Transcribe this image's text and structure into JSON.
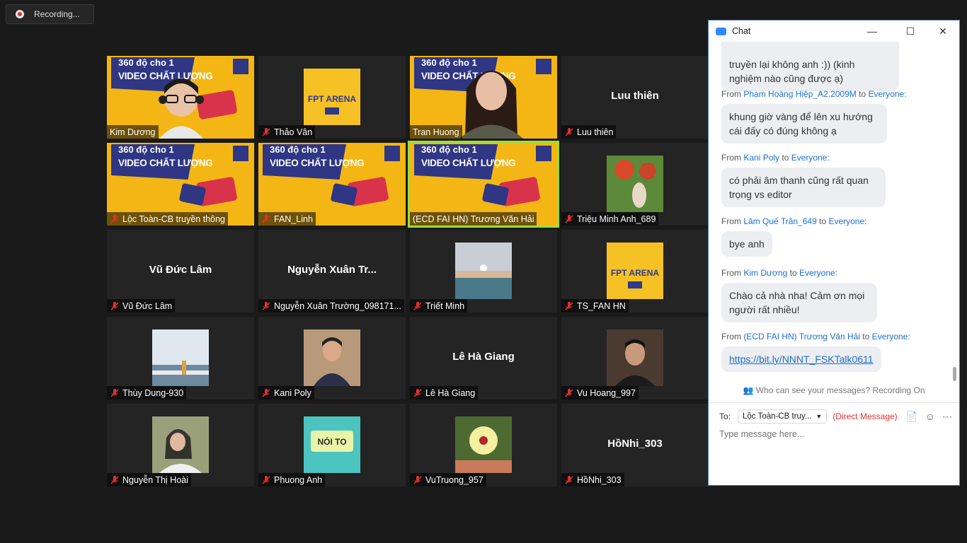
{
  "recording": {
    "label": "Recording..."
  },
  "tiles": [
    {
      "name": "Kim Dương"
    },
    {
      "name": "Thảo Vân"
    },
    {
      "name": "Tran Huong"
    },
    {
      "name": "Luu thiên",
      "big": "Luu thiên"
    },
    {
      "name": "Lộc Toàn-CB truyền thông"
    },
    {
      "name": "FAN_Linh"
    },
    {
      "name": "(ECD FAI HN) Trương Văn Hải"
    },
    {
      "name": "Triệu Minh Anh_689"
    },
    {
      "name": "Vũ Đức Lâm",
      "big": "Vũ Đức Lâm"
    },
    {
      "name": "Nguyễn Xuân Trường_098171...",
      "big": "Nguyễn Xuân Tr..."
    },
    {
      "name": "Triết Minh"
    },
    {
      "name": "TS_FAN HN"
    },
    {
      "name": "Thùy Dung-930"
    },
    {
      "name": "Kani Poly"
    },
    {
      "name": "Lê Hà Giang",
      "big": "Lê Hà Giang"
    },
    {
      "name": "Vu Hoang_997"
    },
    {
      "name": "Nguyễn Thị Hoài"
    },
    {
      "name": "Phuong Anh"
    },
    {
      "name": "VuTruong_957"
    },
    {
      "name": "HồNhi_303",
      "big": "HồNhi_303"
    }
  ],
  "poster": {
    "line1": "360 độ cho 1",
    "line2": "VIDEO CHẤT LƯỢNG"
  },
  "chat": {
    "title": "Chat",
    "messages": [
      {
        "text_lines": [
          "truyền lại không anh :)) (kinh",
          "nghiệm nào cũng được ạ)"
        ]
      },
      {
        "from_label": "From",
        "from": "Phạm Hoàng Hiệp_A2.2009M",
        "to_label": "to",
        "to": "Everyone:",
        "text_lines": [
          "khung giờ vàng để lên xu hướng",
          "cái đấy có đúng không ạ"
        ]
      },
      {
        "from_label": "From",
        "from": "Kani Poly",
        "to_label": "to",
        "to": "Everyone:",
        "text_lines": [
          "có phải âm thanh cũng rất quan",
          "trọng vs  editor"
        ]
      },
      {
        "from_label": "From",
        "from": "Lâm Quế Trân_649",
        "to_label": "to",
        "to": "Everyone:",
        "text_lines": [
          "bye anh"
        ]
      },
      {
        "from_label": "From",
        "from": "Kim Dương",
        "to_label": "to",
        "to": "Everyone:",
        "text_lines": [
          "Chào cả nhà nha! Cảm ơn mọi",
          "người rất nhiều!"
        ]
      },
      {
        "from_label": "From",
        "from": "(ECD FAI HN) Trương Văn Hải",
        "to_label": "to",
        "to": "Everyone:",
        "link": "https://bit.ly/NNNT_FSKTalk0611"
      }
    ],
    "who_can_see": "Who can see your messages? Recording On",
    "to_label": "To:",
    "to_value": "Lộc Toàn-CB truy...",
    "direct_message": "(Direct Message)",
    "placeholder": "Type message here..."
  },
  "colors": {
    "accent": "#2d8cff",
    "active_speaker": "#9adf3a",
    "muted": "#e0312f",
    "poster": "#f4b614"
  }
}
